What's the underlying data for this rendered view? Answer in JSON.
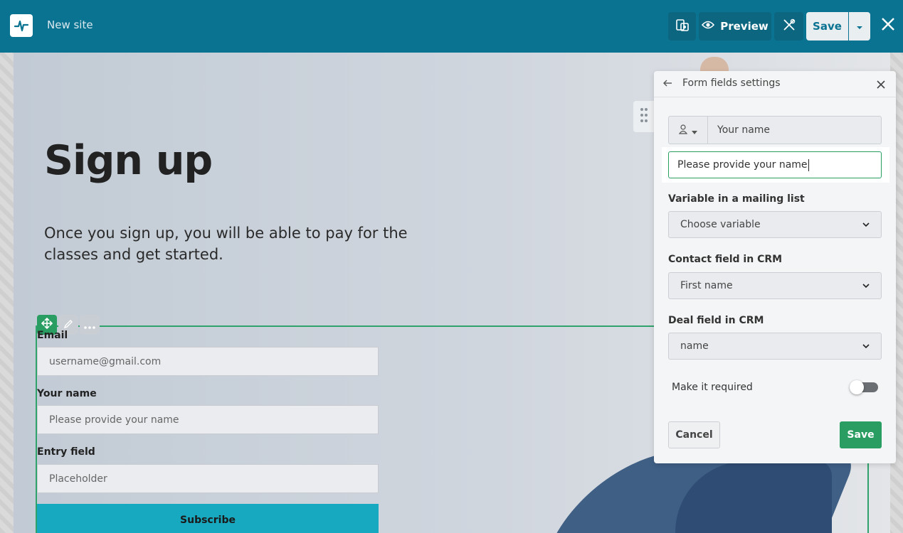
{
  "header": {
    "site_name": "New site",
    "preview_label": "Preview",
    "save_label": "Save"
  },
  "page": {
    "title": "Sign up",
    "description": "Once you sign up, you will be able to pay for the classes and get started."
  },
  "form": {
    "fields": [
      {
        "label": "Email",
        "placeholder": "username@gmail.com"
      },
      {
        "label": "Your name",
        "placeholder": "Please provide your name"
      },
      {
        "label": "Entry field",
        "placeholder": "Placeholder"
      }
    ],
    "submit_label": "Subscribe"
  },
  "panel": {
    "title": "Form fields settings",
    "field_name": "Your name",
    "placeholder_value": "Please provide your name",
    "mailing_variable": {
      "label": "Variable in a mailing list",
      "value": "Choose variable"
    },
    "crm_contact": {
      "label": "Contact field in CRM",
      "value": "First name"
    },
    "crm_deal": {
      "label": "Deal field in CRM",
      "value": "name"
    },
    "required_label": "Make it required",
    "required": false,
    "cancel_label": "Cancel",
    "save_label": "Save"
  },
  "colors": {
    "topbar": "#0a7391",
    "accent_green": "#2a9d62",
    "subscribe": "#17a9bf"
  }
}
